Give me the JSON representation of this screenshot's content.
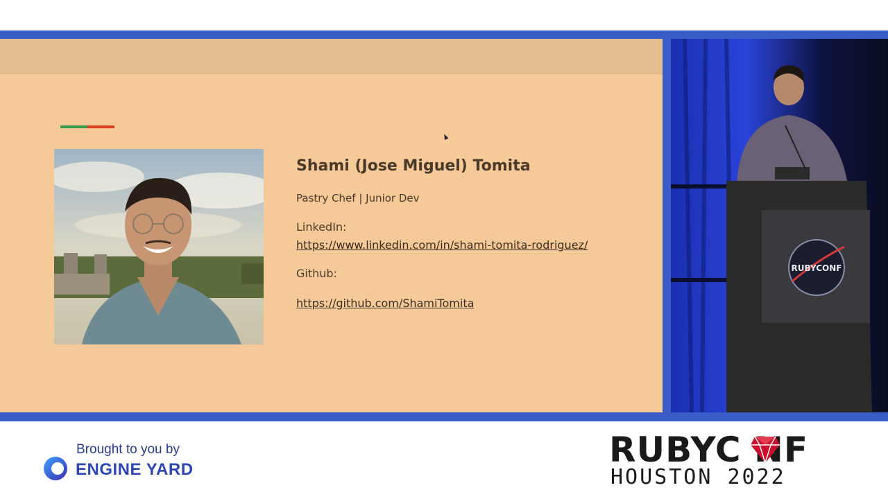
{
  "slide": {
    "name": "Shami (Jose Miguel) Tomita",
    "role": "Pastry Chef | Junior Dev",
    "linkedin_label": "LinkedIn:",
    "linkedin_url": "https://www.linkedin.com/in/shami-tomita-rodriguez/",
    "github_label": "Github:",
    "github_url": "https://github.com/ShamiTomita"
  },
  "footer": {
    "sponsor_intro": "Brought to you by",
    "sponsor_name": "ENGINE YARD",
    "conf_title": "RUBYC NF",
    "conf_subtitle": "HOUSTON 2022"
  },
  "video": {
    "podium_logo": "RUBYCONF"
  },
  "colors": {
    "frame": "#3a5cc6",
    "slide_bg": "#f6c998",
    "slide_header": "#e3bd8e",
    "accent_green": "#3c9a4d",
    "accent_red": "#e0401e",
    "ruby_red": "#c8102e",
    "engine_yard_blue": "#2f47b3"
  }
}
